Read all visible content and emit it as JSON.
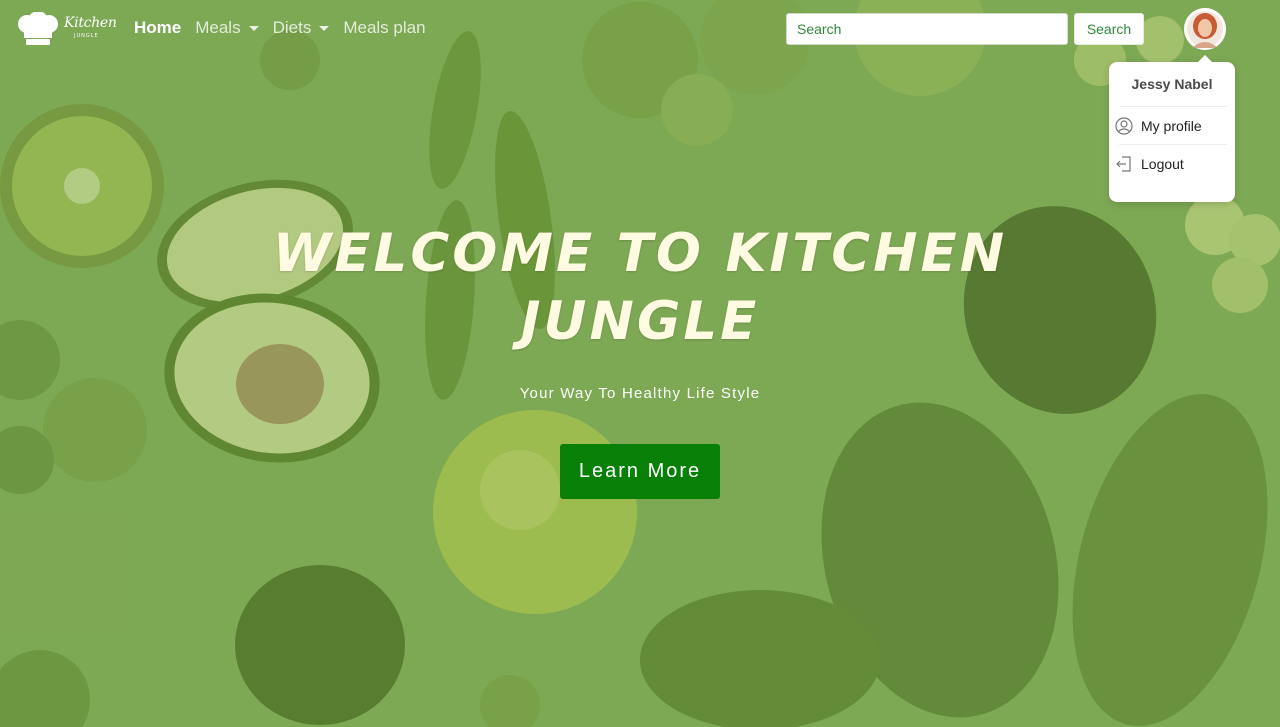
{
  "brand": {
    "name": "Kitchen",
    "tagline": "JUNGLE"
  },
  "nav": {
    "items": [
      {
        "label": "Home",
        "active": true,
        "has_dropdown": false
      },
      {
        "label": "Meals",
        "active": false,
        "has_dropdown": true
      },
      {
        "label": "Diets",
        "active": false,
        "has_dropdown": true
      },
      {
        "label": "Meals plan",
        "active": false,
        "has_dropdown": false
      }
    ]
  },
  "search": {
    "placeholder": "Search",
    "button_label": "Search"
  },
  "user_menu": {
    "name": "Jessy Nabel",
    "items": [
      {
        "label": "My profile",
        "icon": "user-circle-icon"
      },
      {
        "label": "Logout",
        "icon": "logout-icon"
      }
    ]
  },
  "hero": {
    "title": "WELCOME TO KITCHEN JUNGLE",
    "subtitle": "Your Way To Healthy Life Style",
    "cta_label": "Learn More"
  },
  "colors": {
    "background_green": "#7fa85a",
    "accent_green": "#088008",
    "title_cream": "#fffbe3",
    "link_green": "#2f8a3a"
  }
}
